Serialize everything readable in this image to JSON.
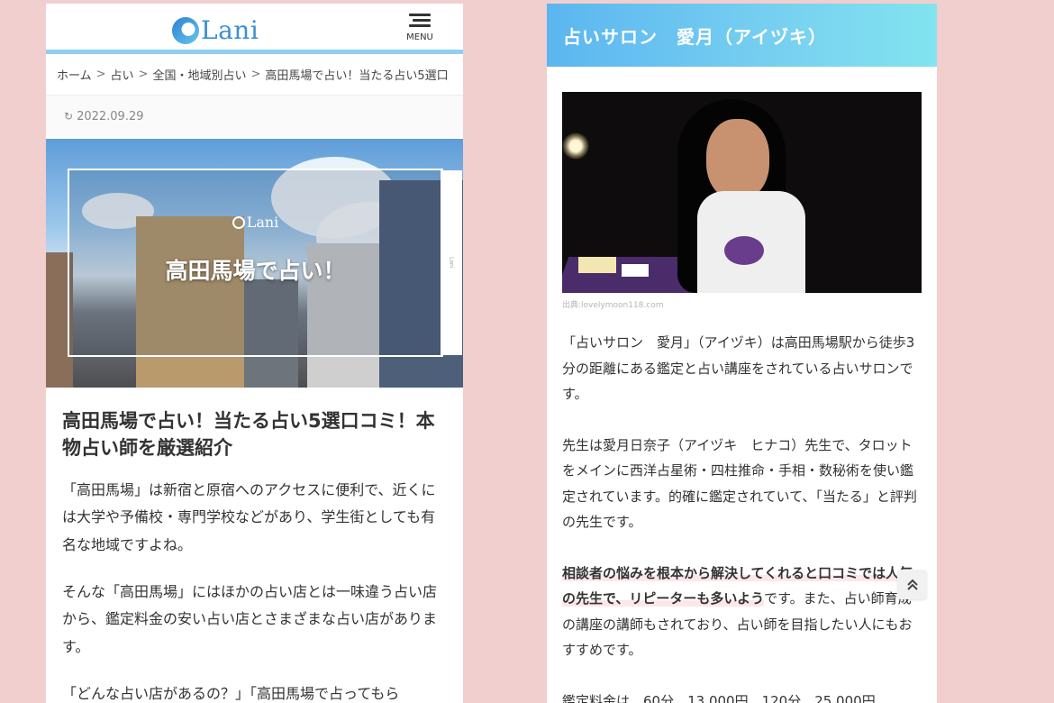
{
  "left": {
    "header": {
      "logo_text": "Lani",
      "menu_label": "MENU"
    },
    "breadcrumb": [
      "ホーム",
      "占い",
      "全国・地域別占い",
      "高田馬場で占い！当たる占い5選口"
    ],
    "date": "2022.09.29",
    "hero": {
      "logo_text": "Lani",
      "title": "高田馬場で占い！"
    },
    "article": {
      "title": "高田馬場で占い！当たる占い5選口コミ！本物占い師を厳選紹介",
      "paragraphs": [
        "「高田馬場」は新宿と原宿へのアクセスに便利で、近くには大学や予備校・専門学校などがあり、学生街としても有名な地域ですよね。",
        "そんな「高田馬場」にはほかの占い店とは一味違う占い店から、鑑定料金の安い占い店とさまざまな占い店があります。",
        "「どんな占い店があるの？」「高田馬場で占ってもら"
      ]
    }
  },
  "right": {
    "section_title": "占いサロン　愛月（アイヅキ）",
    "image_credit": "出典:lovelymoon118.com",
    "paragraphs": {
      "p1": "「占いサロン　愛月」（アイヅキ）は高田馬場駅から徒歩3分の距離にある鑑定と占い講座をされている占いサロンです。",
      "p2": "先生は愛月日奈子（アイヅキ　ヒナコ）先生で、タロットをメインに西洋占星術・四柱推命・手相・数秘術を使い鑑定されています。的確に鑑定されていて、「当たる」と評判の先生です。",
      "p3_bold": "相談者の悩みを根本から解決してくれると口コミでは人気の先生で、リピーターも多いよう",
      "p3_rest": "です。また、占い師育成の講座の講師もされており、占い師を目指したい人にもおすすめです。",
      "p4": "鑑定料金は、60分　13,000円　120分　25,000円"
    },
    "scroll_top_icon": "double-chevron-up-icon"
  },
  "colors": {
    "background": "#f1cfcf",
    "header_gradient_start": "#5bb6f0",
    "header_gradient_end": "#82e4ef",
    "logo": "#3a8fd6"
  }
}
